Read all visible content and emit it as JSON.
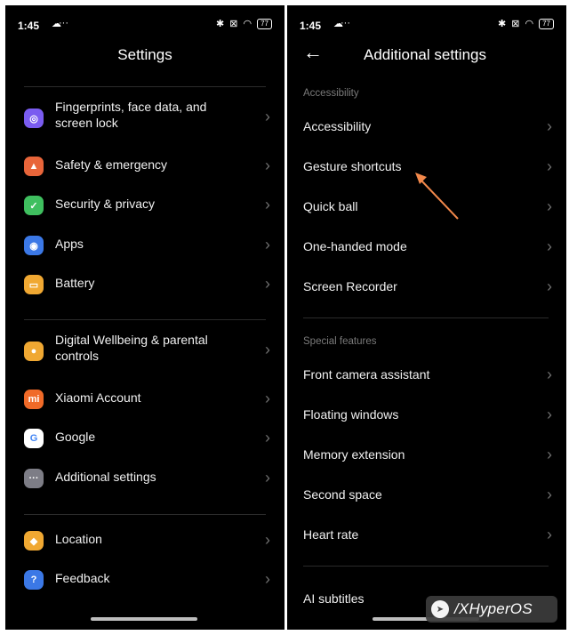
{
  "left": {
    "status": {
      "time": "1:45",
      "battery": "77"
    },
    "title": "Settings",
    "items": [
      {
        "label": "Fingerprints, face data, and screen lock",
        "icon": "fingerprint-icon",
        "icon_color": "#7a5cf0",
        "glyph": "◎"
      },
      {
        "label": "Safety & emergency",
        "icon": "bell-icon",
        "icon_color": "#e8653a",
        "glyph": "▲"
      },
      {
        "label": "Security & privacy",
        "icon": "shield-icon",
        "icon_color": "#3fbf5f",
        "glyph": "✓"
      },
      {
        "label": "Apps",
        "icon": "apps-icon",
        "icon_color": "#3b78e6",
        "glyph": "◉"
      },
      {
        "label": "Battery",
        "icon": "battery-icon",
        "icon_color": "#f0a832",
        "glyph": "▭"
      },
      {
        "label": "Digital Wellbeing & parental controls",
        "icon": "wellbeing-icon",
        "icon_color": "#f0a832",
        "glyph": "●"
      },
      {
        "label": "Xiaomi Account",
        "icon": "xiaomi-icon",
        "icon_color": "#f06a28",
        "glyph": "mi"
      },
      {
        "label": "Google",
        "icon": "google-icon",
        "icon_color": "#ffffff",
        "glyph": "G"
      },
      {
        "label": "Additional settings",
        "icon": "more-icon",
        "icon_color": "#7d7d86",
        "glyph": "···"
      },
      {
        "label": "Location",
        "icon": "location-icon",
        "icon_color": "#f0a832",
        "glyph": "◆"
      },
      {
        "label": "Feedback",
        "icon": "feedback-icon",
        "icon_color": "#3b78e6",
        "glyph": "?"
      }
    ]
  },
  "right": {
    "status": {
      "time": "1:45",
      "battery": "77"
    },
    "title": "Additional settings",
    "section_accessibility": "Accessibility",
    "accessibility_items": [
      {
        "label": "Accessibility"
      },
      {
        "label": "Gesture shortcuts"
      },
      {
        "label": "Quick ball"
      },
      {
        "label": "One-handed mode"
      },
      {
        "label": "Screen Recorder"
      }
    ],
    "section_special": "Special features",
    "special_items": [
      {
        "label": "Front camera assistant"
      },
      {
        "label": "Floating windows"
      },
      {
        "label": "Memory extension"
      },
      {
        "label": "Second space"
      },
      {
        "label": "Heart rate"
      }
    ],
    "bottom_item": {
      "label": "AI subtitles"
    }
  },
  "watermark": "/XHyperOS",
  "annotation_arrow_color": "#f2884b",
  "chevron": "›"
}
